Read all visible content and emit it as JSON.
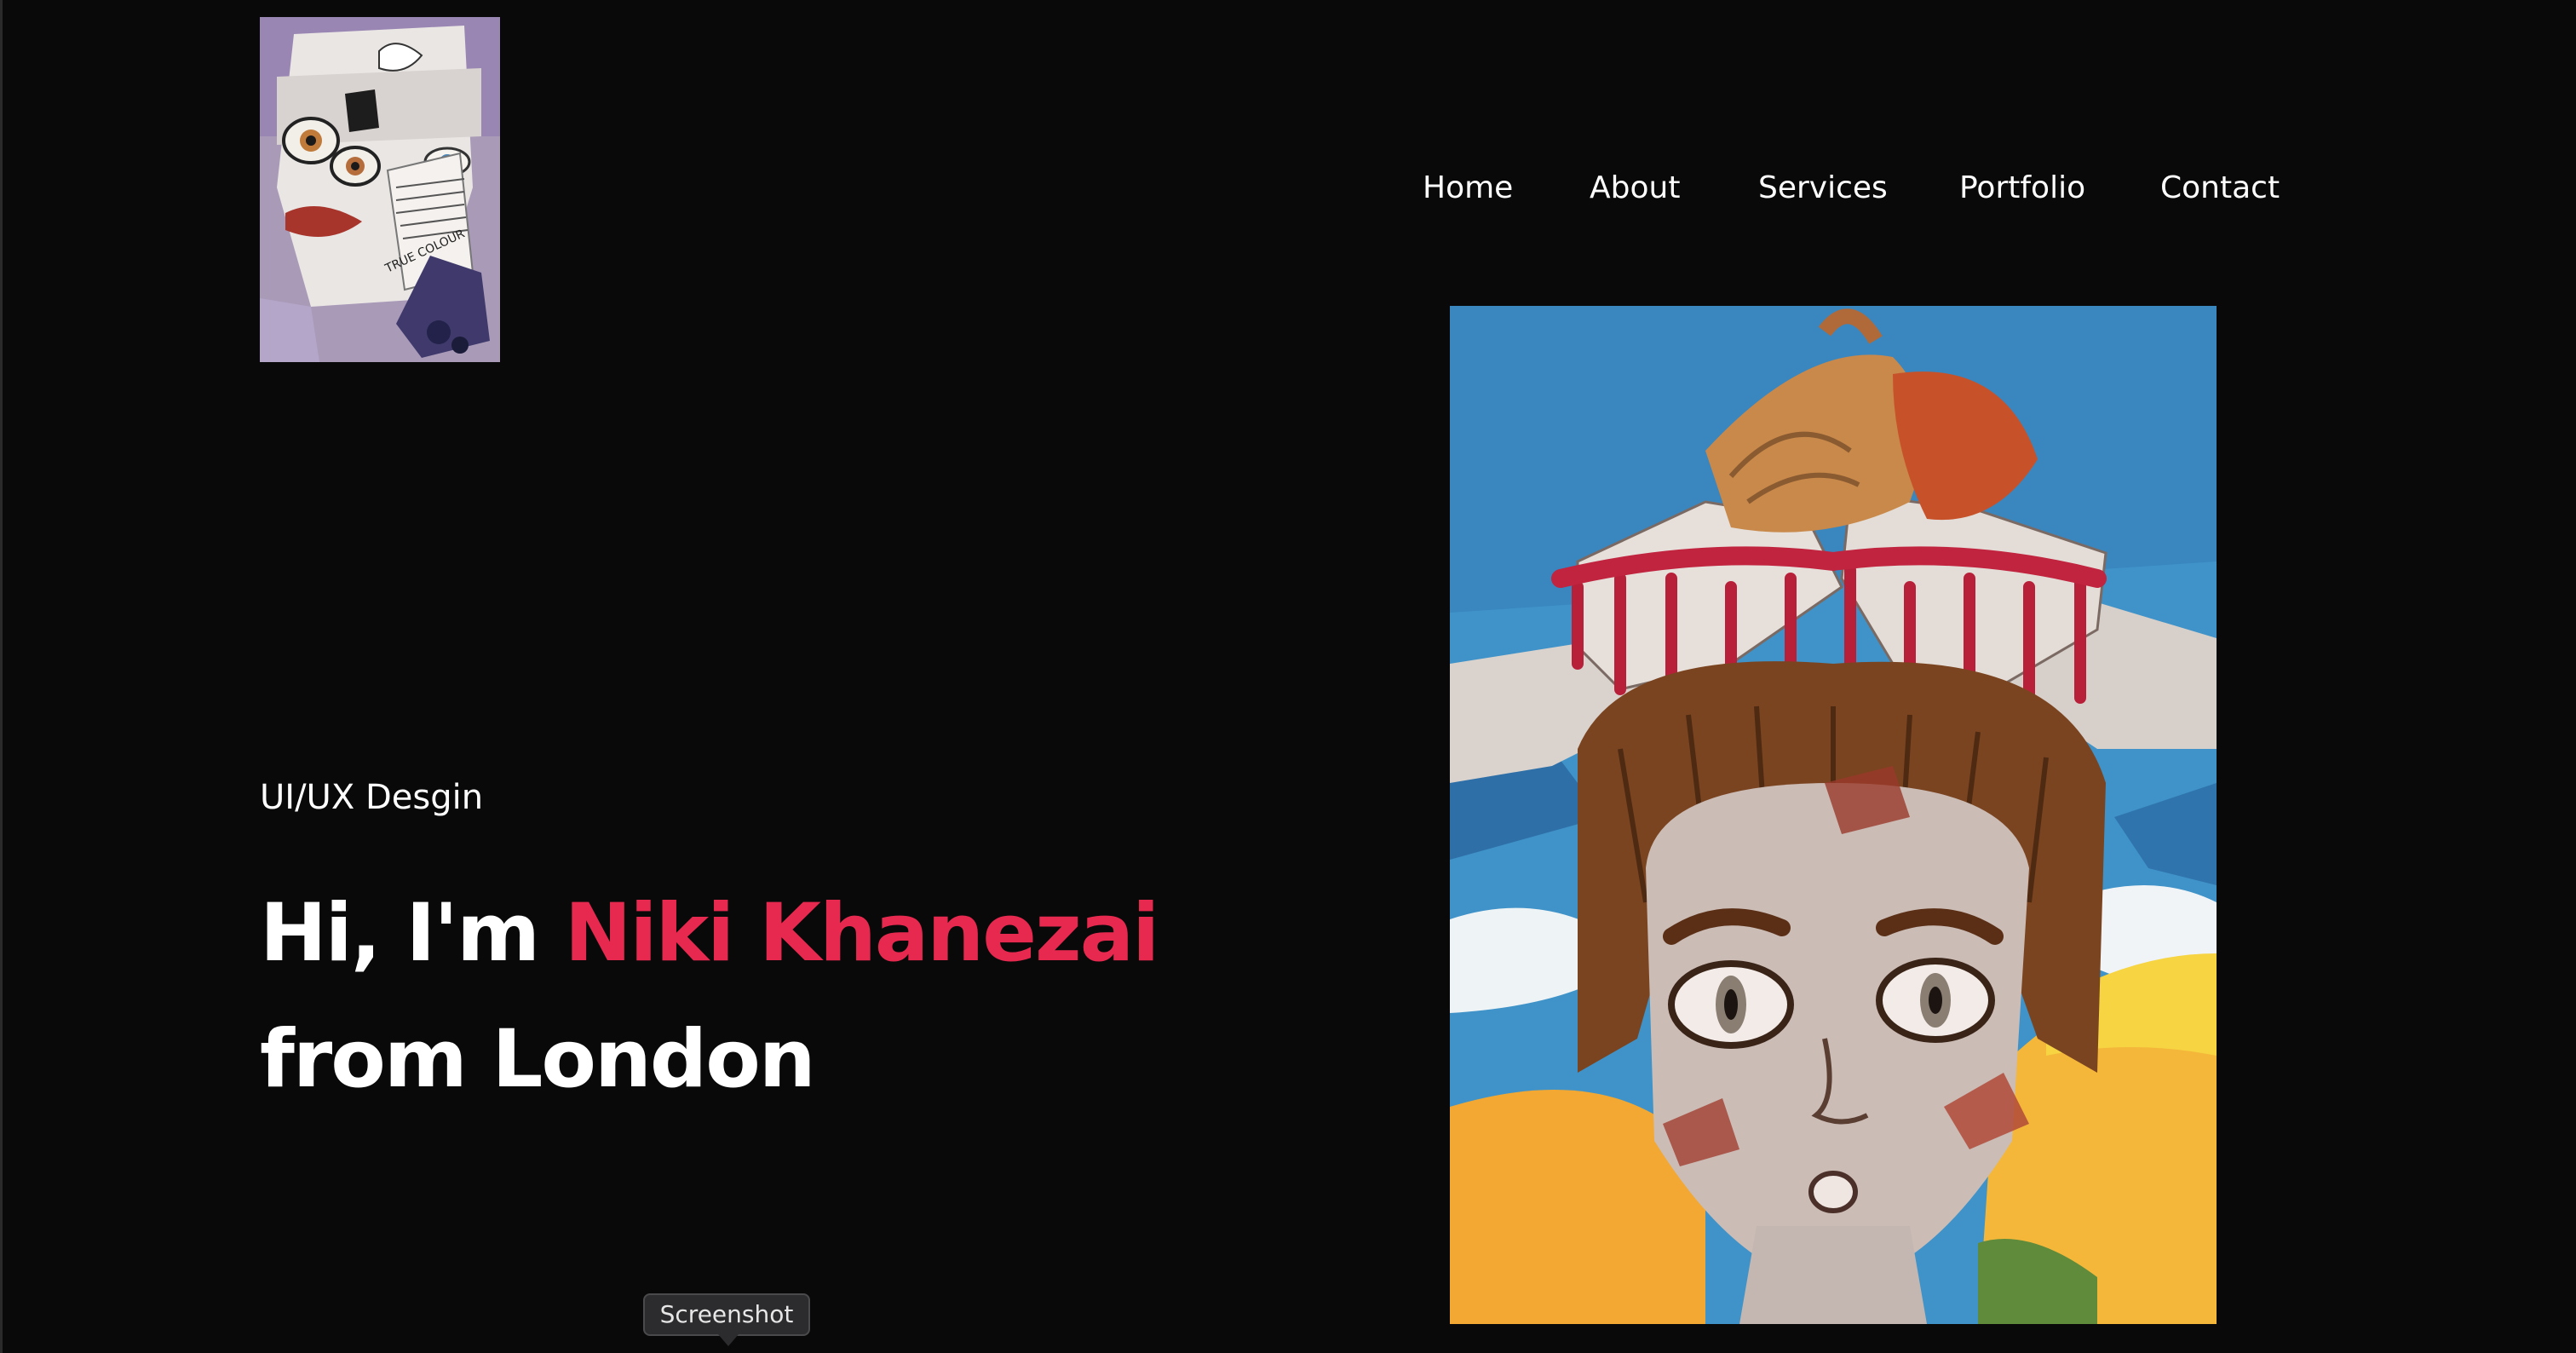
{
  "nav": {
    "items": [
      {
        "label": "Home"
      },
      {
        "label": "About"
      },
      {
        "label": "Services"
      },
      {
        "label": "Portfolio"
      },
      {
        "label": "Contact"
      }
    ]
  },
  "hero": {
    "subtitle": "UI/UX Desgin",
    "greeting": "Hi, I'm",
    "name": "Niki Khanezai",
    "location_line": "from London"
  },
  "logo": {
    "caption": "TRUE COLOUR"
  },
  "tooltip": {
    "label": "Screenshot"
  },
  "colors": {
    "background": "#0a090a",
    "accent": "#e8294f",
    "text": "#ffffff"
  }
}
